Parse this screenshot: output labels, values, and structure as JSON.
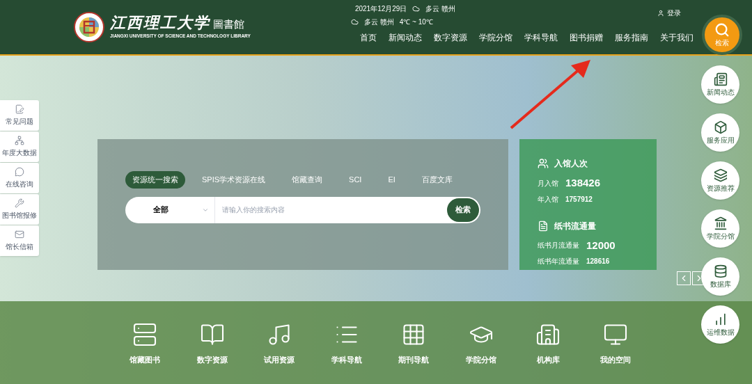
{
  "header": {
    "logo": {
      "title": "江西理工大学",
      "suffix": "圖書館",
      "english": "JIANGXI UNIVERSITY OF SCIENCE AND TECHNOLOGY LIBRARY"
    },
    "weather": [
      {
        "date": "2021年12月29日",
        "condition": "多云",
        "city": "赣州"
      },
      {
        "condition": "多云",
        "city": "赣州",
        "temperature": "4℃ ~ 10℃"
      }
    ],
    "login": "登录",
    "nav": [
      "首页",
      "新闻动态",
      "数字资源",
      "学院分馆",
      "学科导航",
      "图书捐赠",
      "服务指南",
      "关于我们"
    ],
    "search_button": "检索"
  },
  "left_sidebar": [
    "常见问题",
    "年度大数据",
    "在线咨询",
    "图书馆报修",
    "馆长信箱"
  ],
  "search": {
    "tabs": [
      {
        "label": "资源统一搜索",
        "selected": true
      },
      {
        "label": "SPIS学术资源在线",
        "selected": false
      },
      {
        "label": "馆藏查询",
        "selected": false
      },
      {
        "label": "SCI",
        "selected": false
      },
      {
        "label": "EI",
        "selected": false
      },
      {
        "label": "百度文库",
        "selected": false
      }
    ],
    "scope": "全部",
    "placeholder": "请输入你的搜索内容",
    "button": "检索"
  },
  "stats": [
    {
      "title": "入馆人次",
      "rows": [
        {
          "label": "月入馆",
          "value": "138426"
        },
        {
          "label": "年入馆",
          "value": "1757912"
        }
      ]
    },
    {
      "title": "纸书流通量",
      "rows": [
        {
          "label": "纸书月流通量",
          "value": "12000"
        },
        {
          "label": "纸书年流通量",
          "value": "128616"
        }
      ]
    }
  ],
  "right_float": [
    "新闻动态",
    "服务应用",
    "资源推荐",
    "学院分馆",
    "数据库",
    "运维数据"
  ],
  "quick_links": [
    "馆藏图书",
    "数字资源",
    "试用资源",
    "学科导航",
    "期刊导航",
    "学院分馆",
    "机构库",
    "我的空间"
  ]
}
